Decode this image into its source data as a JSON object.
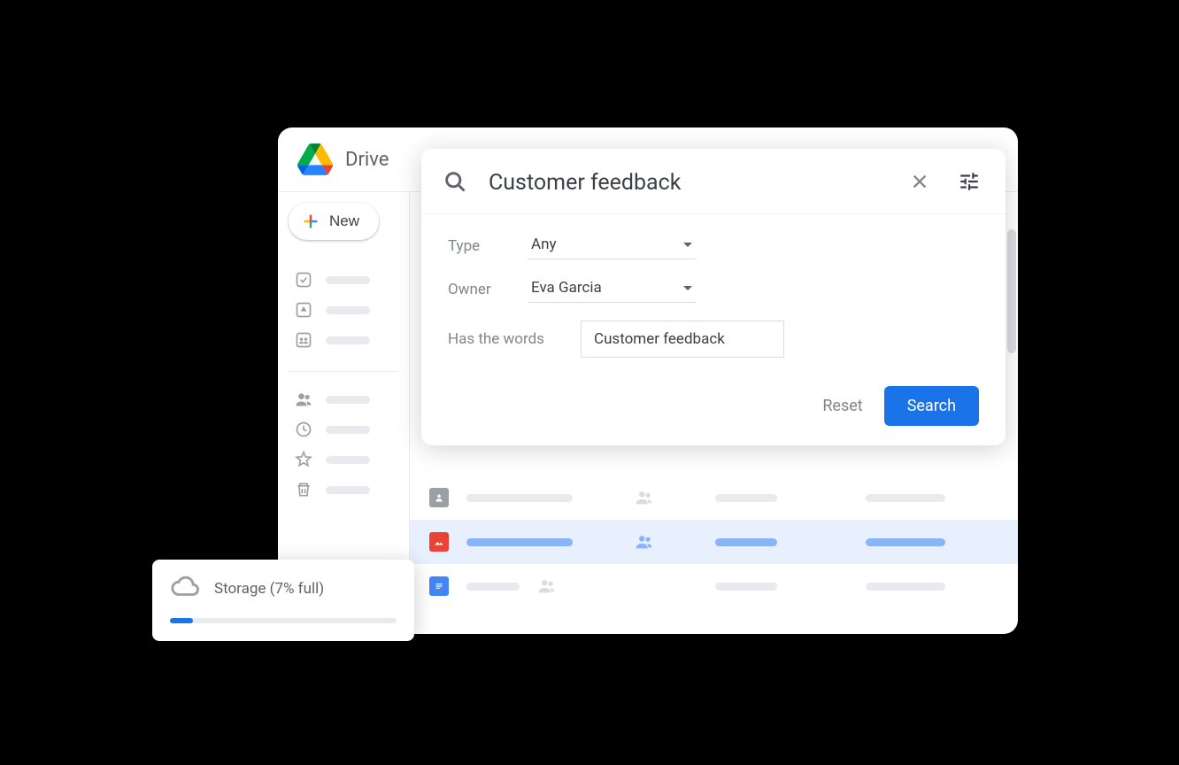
{
  "app": {
    "name": "Drive"
  },
  "sidebar": {
    "new_label": "New"
  },
  "search": {
    "query": "Customer feedback",
    "filters": {
      "type_label": "Type",
      "type_value": "Any",
      "owner_label": "Owner",
      "owner_value": "Eva Garcia",
      "words_label": "Has the words",
      "words_value": "Customer feedback"
    },
    "actions": {
      "reset": "Reset",
      "search": "Search"
    }
  },
  "storage": {
    "label": "Storage (7% full)",
    "percent": 7
  }
}
